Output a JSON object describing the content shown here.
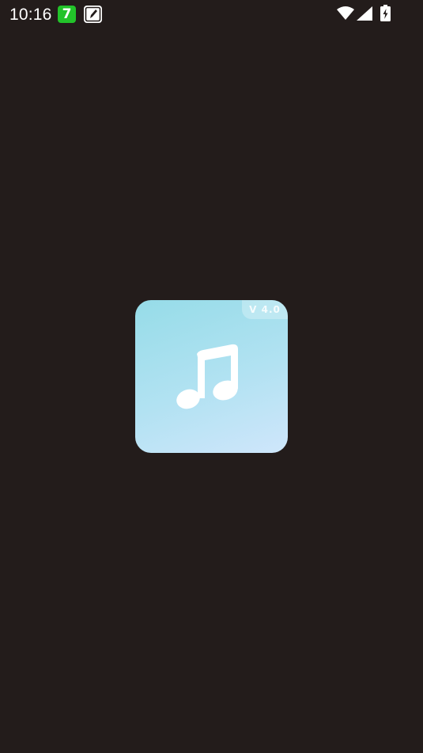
{
  "status_bar": {
    "time": "10:16",
    "notification_app_badge": "7",
    "icons": [
      "app-notification-icon",
      "edit-notification-icon",
      "wifi-icon",
      "signal-icon",
      "battery-charging-icon"
    ]
  },
  "splash": {
    "logo_icon": "music-note-icon",
    "version": "V 4.0"
  },
  "colors": {
    "background": "#231c1b",
    "logo_gradient_start": "#96dce8",
    "logo_gradient_end": "#cfe6fb",
    "notification_green": "#22c32a"
  }
}
